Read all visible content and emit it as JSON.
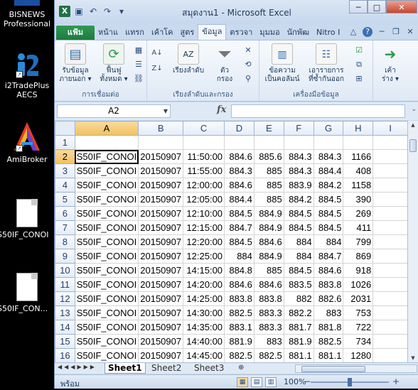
{
  "desktop": {
    "icons": [
      {
        "label_1": "BISNEWS",
        "label_2": "Professional",
        "icon": "bisnews-icon"
      },
      {
        "label_1": "i2TradePlus",
        "label_2": "AECS",
        "icon": "i2tradeplus-icon"
      },
      {
        "label_1": "AmiBroker",
        "label_2": "",
        "icon": "amibroker-icon"
      },
      {
        "label_1": "S50IF_CONOI",
        "label_2": "",
        "icon": "file-icon"
      },
      {
        "label_1": "S50IF_CON...",
        "label_2": "",
        "icon": "file-icon"
      }
    ]
  },
  "window": {
    "title": "สมุดงาน1 - Microsoft Excel",
    "minimize": "─",
    "maximize": "□",
    "close": "✕"
  },
  "ribbon": {
    "tabs": [
      "แฟ้ม",
      "หน้าแ",
      "แทรก",
      "เค้าโค",
      "สูตร",
      "ข้อมูล",
      "ตรวจา",
      "มุมมอ",
      "นักพัฒ",
      "Nitro I"
    ],
    "active_tab": "ข้อมูล",
    "groups": {
      "connections": "การเชื่อมต่อ",
      "sort_filter": "เรียงลำดับและกรอง",
      "data_tools": "เครื่องมือข้อมูล"
    },
    "buttons": {
      "get_data_1": "รับข้อมูล",
      "get_data_2": "ภายนอก ▾",
      "refresh_1": "ฟื้นฟู",
      "refresh_2": "ทั้งหมด ▾",
      "sort": "เรียงลำดับ",
      "filter_1": "ตัว",
      "filter_2": "กรอง",
      "text_to_columns_1": "ข้อความ",
      "text_to_columns_2": "เป็นคอลัมน์",
      "remove_dup_1": "เอารายการ",
      "remove_dup_2": "ที่ซ้ำกันออก",
      "outline_1": "เค้า",
      "outline_2": "ร่าง ▾"
    }
  },
  "formula_bar": {
    "name_box": "A2",
    "fx": "fx",
    "value": ""
  },
  "grid": {
    "columns": [
      "A",
      "B",
      "C",
      "D",
      "E",
      "F",
      "G",
      "H",
      "I"
    ],
    "selected_column": "A",
    "rows": [
      {
        "n": "1",
        "a": "",
        "b": "",
        "c": "",
        "d": "",
        "e": "",
        "f": "",
        "g": "",
        "h": ""
      },
      {
        "n": "2",
        "a": "S50IF_CONOI",
        "b": "20150907",
        "c": "11:50:00",
        "d": "884.6",
        "e": "885.6",
        "f": "884.3",
        "g": "884.3",
        "h": "1166"
      },
      {
        "n": "3",
        "a": "S50IF_CONOI",
        "b": "20150907",
        "c": "11:55:00",
        "d": "884.3",
        "e": "885",
        "f": "884.3",
        "g": "884.4",
        "h": "408"
      },
      {
        "n": "4",
        "a": "S50IF_CONOI",
        "b": "20150907",
        "c": "12:00:00",
        "d": "884.6",
        "e": "885",
        "f": "883.9",
        "g": "884.2",
        "h": "1158"
      },
      {
        "n": "5",
        "a": "S50IF_CONOI",
        "b": "20150907",
        "c": "12:05:00",
        "d": "884.4",
        "e": "885",
        "f": "884.2",
        "g": "884.5",
        "h": "390"
      },
      {
        "n": "6",
        "a": "S50IF_CONOI",
        "b": "20150907",
        "c": "12:10:00",
        "d": "884.5",
        "e": "884.9",
        "f": "884.5",
        "g": "884.5",
        "h": "269"
      },
      {
        "n": "7",
        "a": "S50IF_CONOI",
        "b": "20150907",
        "c": "12:15:00",
        "d": "884.7",
        "e": "884.9",
        "f": "884.5",
        "g": "884.5",
        "h": "411"
      },
      {
        "n": "8",
        "a": "S50IF_CONOI",
        "b": "20150907",
        "c": "12:20:00",
        "d": "884.5",
        "e": "884.6",
        "f": "884",
        "g": "884",
        "h": "799"
      },
      {
        "n": "9",
        "a": "S50IF_CONOI",
        "b": "20150907",
        "c": "12:25:00",
        "d": "884",
        "e": "884.9",
        "f": "884",
        "g": "884.7",
        "h": "869"
      },
      {
        "n": "10",
        "a": "S50IF_CONOI",
        "b": "20150907",
        "c": "14:15:00",
        "d": "884.8",
        "e": "885",
        "f": "884.5",
        "g": "884.6",
        "h": "918"
      },
      {
        "n": "11",
        "a": "S50IF_CONOI",
        "b": "20150907",
        "c": "14:20:00",
        "d": "884.6",
        "e": "884.6",
        "f": "883.5",
        "g": "883.8",
        "h": "1026"
      },
      {
        "n": "12",
        "a": "S50IF_CONOI",
        "b": "20150907",
        "c": "14:25:00",
        "d": "883.8",
        "e": "883.8",
        "f": "882",
        "g": "882.6",
        "h": "2031"
      },
      {
        "n": "13",
        "a": "S50IF_CONOI",
        "b": "20150907",
        "c": "14:30:00",
        "d": "882.5",
        "e": "883.3",
        "f": "882.2",
        "g": "883",
        "h": "753"
      },
      {
        "n": "14",
        "a": "S50IF_CONOI",
        "b": "20150907",
        "c": "14:35:00",
        "d": "883.1",
        "e": "883.3",
        "f": "881.7",
        "g": "881.8",
        "h": "722"
      },
      {
        "n": "15",
        "a": "S50IF_CONOI",
        "b": "20150907",
        "c": "14:40:00",
        "d": "881.9",
        "e": "883",
        "f": "881.9",
        "g": "882.5",
        "h": "734"
      },
      {
        "n": "16",
        "a": "S50IF_CONOI",
        "b": "20150907",
        "c": "14:45:00",
        "d": "882.5",
        "e": "882.5",
        "f": "881.1",
        "g": "881.1",
        "h": "1280"
      }
    ]
  },
  "sheets": {
    "tabs": [
      "Sheet1",
      "Sheet2",
      "Sheet3"
    ],
    "active": "Sheet1"
  },
  "status": {
    "ready": "พร้อม",
    "zoom": "100%",
    "zoom_minus": "−",
    "zoom_plus": "+"
  },
  "colors": {
    "accent": "#1f7244",
    "selection": "#f1c15f"
  }
}
